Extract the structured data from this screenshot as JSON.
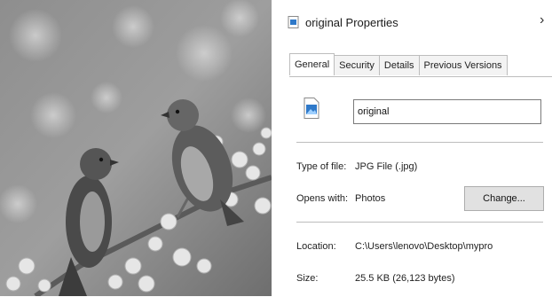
{
  "dialog": {
    "title": "original Properties",
    "close_icon": "chevron-right-icon",
    "tabs": [
      {
        "label": "General",
        "active": true
      },
      {
        "label": "Security",
        "active": false
      },
      {
        "label": "Details",
        "active": false
      },
      {
        "label": "Previous Versions",
        "active": false
      }
    ],
    "file_name": "original",
    "file_icon": "image-file-icon",
    "type_label": "Type of file:",
    "type_value": "JPG File (.jpg)",
    "opens_label": "Opens with:",
    "opens_value": "Photos",
    "change_label": "Change...",
    "location_label": "Location:",
    "location_value": "C:\\Users\\lenovo\\Desktop\\mypro",
    "size_label": "Size:",
    "size_value": "25.5 KB (26,123 bytes)"
  },
  "colors": {
    "accent": "#2f79c9",
    "border": "#bdbdbd",
    "button_face": "#e1e1e1"
  }
}
